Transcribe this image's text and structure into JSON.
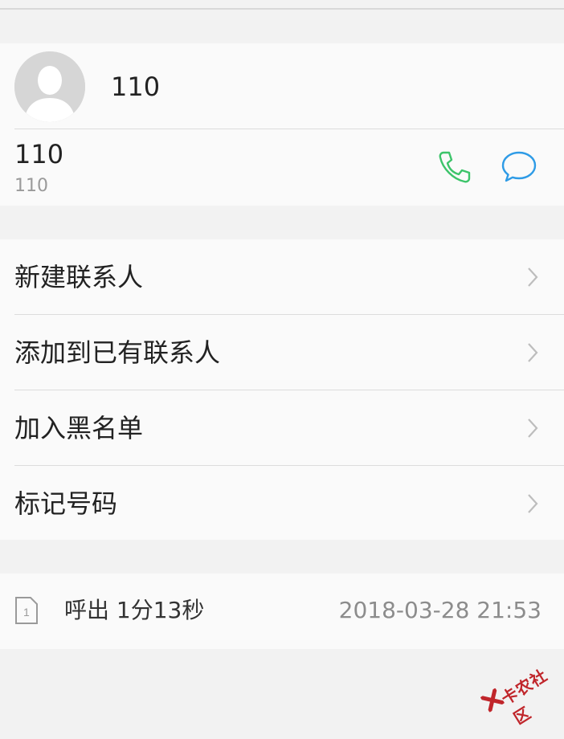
{
  "header": {
    "contact_name": "110",
    "phone_number": "110",
    "phone_label": "110"
  },
  "menu": {
    "items": [
      {
        "label": "新建联系人"
      },
      {
        "label": "添加到已有联系人"
      },
      {
        "label": "加入黑名单"
      },
      {
        "label": "标记号码"
      }
    ]
  },
  "call_log": {
    "type_duration": "呼出 1分13秒",
    "timestamp": "2018-03-28 21:53",
    "sim_slot": "1"
  },
  "watermark": {
    "text": "卡农社区"
  },
  "colors": {
    "call_icon": "#3cc46a",
    "message_icon": "#2e9be6",
    "watermark": "#c0262b"
  },
  "icons": [
    "avatar-placeholder",
    "phone-icon",
    "message-icon",
    "chevron-right-icon",
    "sim-card-icon"
  ]
}
